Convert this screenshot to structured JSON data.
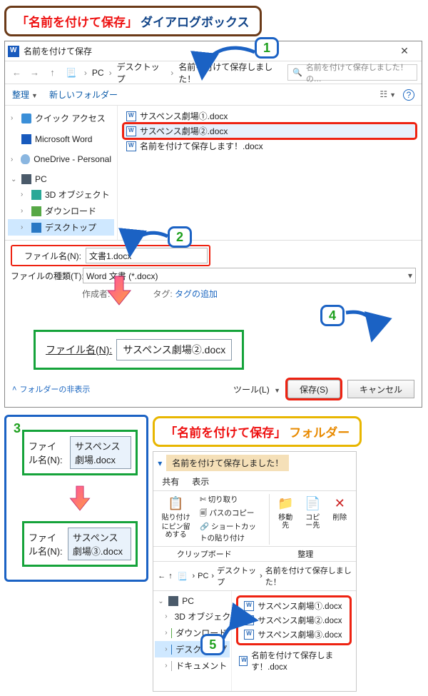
{
  "annotations": {
    "header1_quoted": "「名前を付けて保存」",
    "header1_rest": "ダイアログボックス",
    "header2_quoted": "「名前を付けて保存」",
    "header2_rest": "フォルダー"
  },
  "badges": {
    "n1": "1",
    "n2": "2",
    "n3": "3",
    "n4": "4",
    "n5": "5"
  },
  "dialog": {
    "title": "名前を付けて保存",
    "breadcrumb": {
      "pc": "PC",
      "desktop": "デスクトップ",
      "folder": "名前を付けて保存しました！"
    },
    "search_placeholder": "名前を付けて保存しました！の…",
    "organize": "整理",
    "new_folder": "新しいフォルダー",
    "tree": {
      "quick": "クイック アクセス",
      "word": "Microsoft Word",
      "onedrive": "OneDrive - Personal",
      "pc": "PC",
      "obj3d": "3D オブジェクト",
      "downloads": "ダウンロード",
      "desktop": "デスクトップ"
    },
    "files": {
      "f1": "サスペンス劇場①.docx",
      "f2": "サスペンス劇場②.docx",
      "f3": "名前を付けて保存します！.docx"
    },
    "fn_label": "ファイル名(N):",
    "fn_value": "文書1.docx",
    "ft_label": "ファイルの種類(T):",
    "ft_value": "Word 文書 (*.docx)",
    "author_label": "作成者:",
    "tag_label": "タグ:",
    "tag_value": "タグの追加",
    "folder_toggle": "フォルダーの非表示",
    "tools": "ツール(L)",
    "save": "保存(S)",
    "cancel": "キャンセル"
  },
  "green_fn": {
    "label": "ファイル名(N):",
    "value": "サスペンス劇場②.docx"
  },
  "step3": {
    "label": "ファイル名(N):",
    "value_before": "サスペンス劇場.docx",
    "value_after": "サスペンス劇場③.docx"
  },
  "explorer": {
    "title": "名前を付けて保存しました！",
    "tabs": {
      "share": "共有",
      "view": "表示"
    },
    "ribbon": {
      "pin": "にピン留めする",
      "copy": "コピー",
      "paste": "貼り付け",
      "cut": "切り取り",
      "copypath": "パスのコピー",
      "paste_shortcut": "ショートカットの貼り付け",
      "moveto": "移動先",
      "copyto": "コピー先",
      "delete": "削除",
      "clipboard": "クリップボード",
      "organize": "整理"
    },
    "breadcrumb": {
      "pc": "PC",
      "desktop": "デスクトップ",
      "folder": "名前を付けて保存しました！"
    },
    "tree": {
      "pc": "PC",
      "obj3d": "3D オブジェクト",
      "downloads": "ダウンロード",
      "desktop": "デスクトップ",
      "documents": "ドキュメント"
    },
    "files": {
      "f1": "サスペンス劇場①.docx",
      "f2": "サスペンス劇場②.docx",
      "f3": "サスペンス劇場③.docx",
      "f4": "名前を付けて保存します！.docx"
    }
  }
}
